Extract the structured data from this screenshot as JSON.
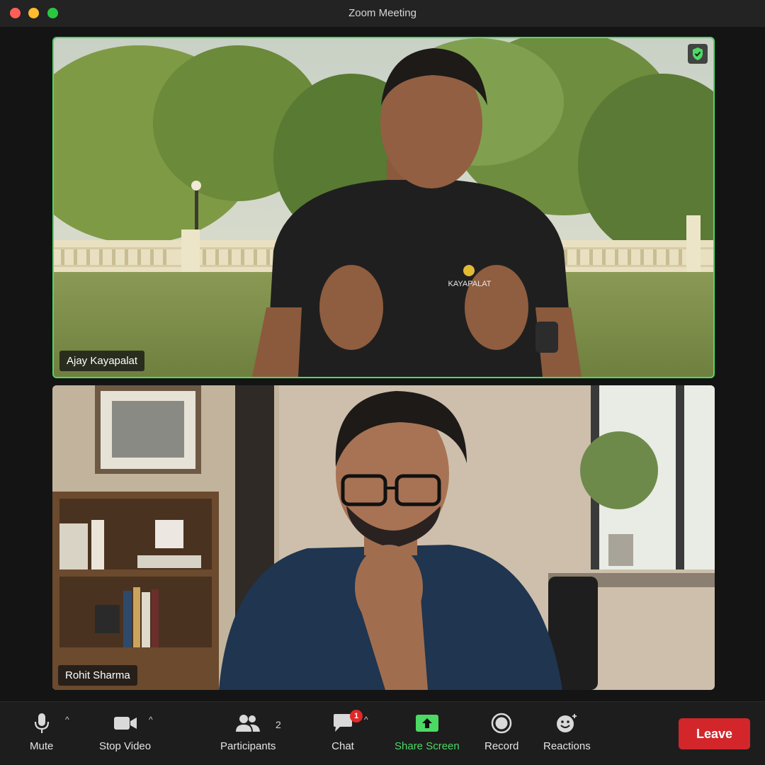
{
  "window": {
    "title": "Zoom Meeting"
  },
  "participants_video": [
    {
      "name": "Ajay Kayapalat",
      "shirt_logo": "KAYAPALAT",
      "active_speaker": true
    },
    {
      "name": "Rohit Sharma",
      "active_speaker": false
    }
  ],
  "toolbar": {
    "mute_label": "Mute",
    "stop_video_label": "Stop Video",
    "participants_label": "Participants",
    "participants_count": "2",
    "chat_label": "Chat",
    "chat_badge": "1",
    "share_screen_label": "Share Screen",
    "record_label": "Record",
    "reactions_label": "Reactions",
    "leave_label": "Leave"
  },
  "colors": {
    "accent_green": "#4cd964",
    "leave_red": "#d3262a",
    "background": "#141414"
  },
  "icons": [
    "microphone-icon",
    "video-camera-icon",
    "participants-icon",
    "chat-icon",
    "share-screen-icon",
    "record-icon",
    "reactions-icon",
    "encryption-shield-icon"
  ]
}
